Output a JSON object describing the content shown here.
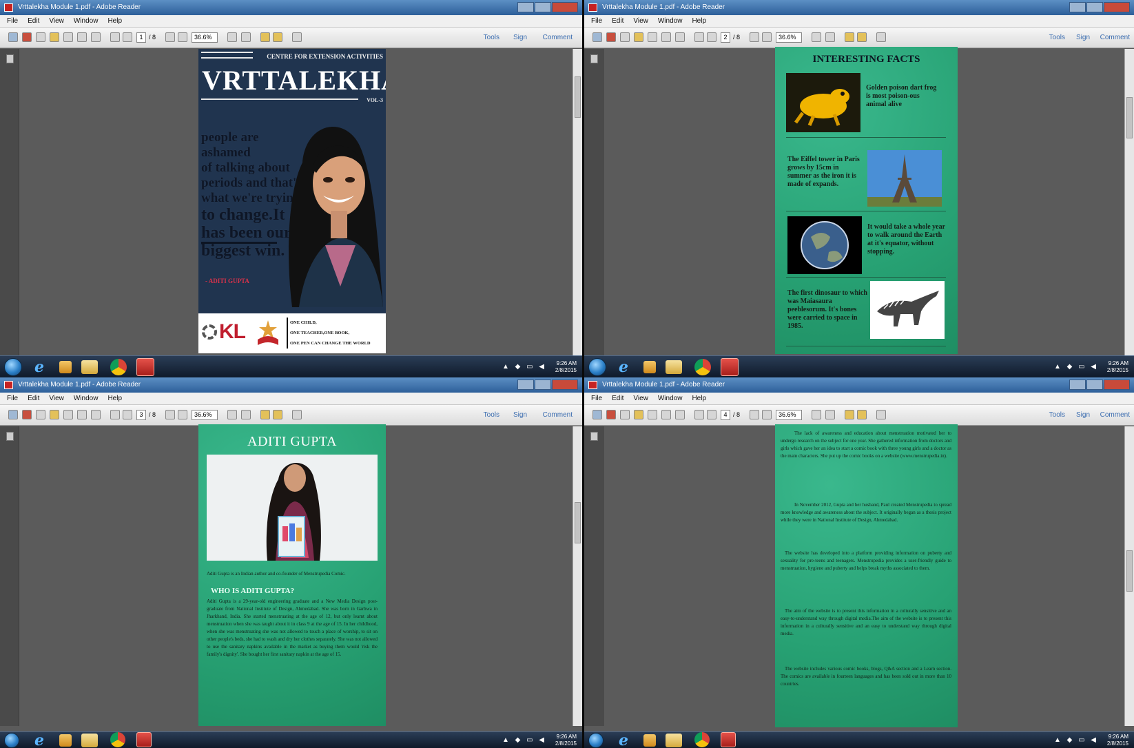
{
  "screens": [
    {
      "window": {
        "title": "Vrttalekha Module 1.pdf - Adobe Reader"
      },
      "menu": [
        "File",
        "Edit",
        "View",
        "Window",
        "Help"
      ],
      "toolbar": {
        "page_current": "1",
        "page_total": "/ 8",
        "zoom": "36.6%",
        "tools": "Tools",
        "sign": "Sign",
        "comment": "Comment"
      },
      "taskbar": {
        "time": "9:26 AM",
        "date": "2/8/2015"
      },
      "cover": {
        "centre": "CENTRE FOR EXTENSION ACTIVITIES",
        "title": "VRTTALEKHA",
        "vol": "VOL-3",
        "quote_lines": [
          "people are ashamed",
          "of talking about",
          "periods and that's",
          "what we're trying",
          "to change.It",
          "has been our",
          "biggest win."
        ],
        "signature": "- ADITI GUPTA",
        "logo": "KL",
        "motto": [
          "ONE CHILD,",
          "ONE TEACHER,ONE BOOK,",
          "ONE PEN CAN CHANGE THE WORLD"
        ]
      }
    },
    {
      "window": {
        "title": "Vrttalekha Module 1.pdf - Adobe Reader"
      },
      "menu": [
        "File",
        "Edit",
        "View",
        "Window",
        "Help"
      ],
      "toolbar": {
        "page_current": "2",
        "page_total": "/ 8",
        "zoom": "36.6%",
        "tools": "Tools",
        "sign": "Sign",
        "comment": "Comment"
      },
      "taskbar": {
        "time": "9:26 AM",
        "date": "2/8/2015"
      },
      "facts": {
        "heading": "INTERESTING FACTS",
        "items": [
          {
            "text": "Golden poison dart frog is most poison-ous animal alive"
          },
          {
            "text": "The Eiffel tower in Paris grows by 15cm in summer as the iron it is made of expands."
          },
          {
            "text": "It would take a whole year to walk around the Earth at it's equator, without stopping."
          },
          {
            "text": "The first dinosaur to which was Maiasaura peeblesorum. It's bones were carried to space in 1985."
          }
        ]
      }
    },
    {
      "window": {
        "title": "Vrttalekha Module 1.pdf - Adobe Reader"
      },
      "menu": [
        "File",
        "Edit",
        "View",
        "Window",
        "Help"
      ],
      "toolbar": {
        "page_current": "3",
        "page_total": "/ 8",
        "zoom": "36.6%",
        "tools": "Tools",
        "sign": "Sign",
        "comment": "Comment"
      },
      "taskbar": {
        "time": "9:26 AM",
        "date": "2/8/2015"
      },
      "profile": {
        "name": "ADITI GUPTA",
        "intro": "Aditi Gupta is an Indian author and co-founder of Menstrupedia Comic.",
        "subheading": "WHO IS ADITI GUPTA?",
        "body": "Aditi Gupta is a 29-year-old engineering graduate and a New Media Design post-graduate from National Institute of Design, Ahmedabad. She was born in Garhwa in Jharkhand, India. She started menstruating at the age of 12, but only learnt about menstruation when she was taught about it in class 9 at the age of 15. In her childhood, when she was menstruating she was not allowed to touch a place of worship, to sit on other people's beds, she had to wash and dry her clothes separately. She was not allowed to use the sanitary napkins available in the market as buying them would 'risk the family's dignity'. She bought her first sanitary napkin at the age of 15."
      }
    },
    {
      "window": {
        "title": "Vrttalekha Module 1.pdf - Adobe Reader"
      },
      "menu": [
        "File",
        "Edit",
        "View",
        "Window",
        "Help"
      ],
      "toolbar": {
        "page_current": "4",
        "page_total": "/ 8",
        "zoom": "36.6%",
        "tools": "Tools",
        "sign": "Sign",
        "comment": "Comment"
      },
      "taskbar": {
        "time": "9:26 AM",
        "date": "2/8/2015"
      },
      "article": {
        "paragraphs": [
          "The lack of awareness and education about menstruation motivated her to undergo research on the subject for one year. She gathered information from doctors and girls which gave her an idea to start a comic book with three young girls and a doctor as the main characters. She put up the comic books on a website (www.menstrupedia.in).",
          "In November 2012, Gupta and her husband, Paul created Menstrupedia to spread more knowledge and awareness about the subject. It originally began as a thesis project while they were in National Institute of Design, Ahmedabad.",
          "The website has developed into a platform providing information on puberty and sexuality for pre-teens and teenagers. Menstrupedia provides a user-friendly guide to menstruation, hygiene and puberty and helps break myths associated to them.",
          "The aim of the website is to present this information in a culturally sensitive and an easy-to-understand way through digital media.The aim of the website is to present this information in a culturally sensitive and an easy to understand way through digital media.",
          "The website includes various comic books, blogs, Q&A section and a Learn section. The comics are available in fourteen languages and has been sold out in more than 10 countries."
        ]
      }
    }
  ]
}
